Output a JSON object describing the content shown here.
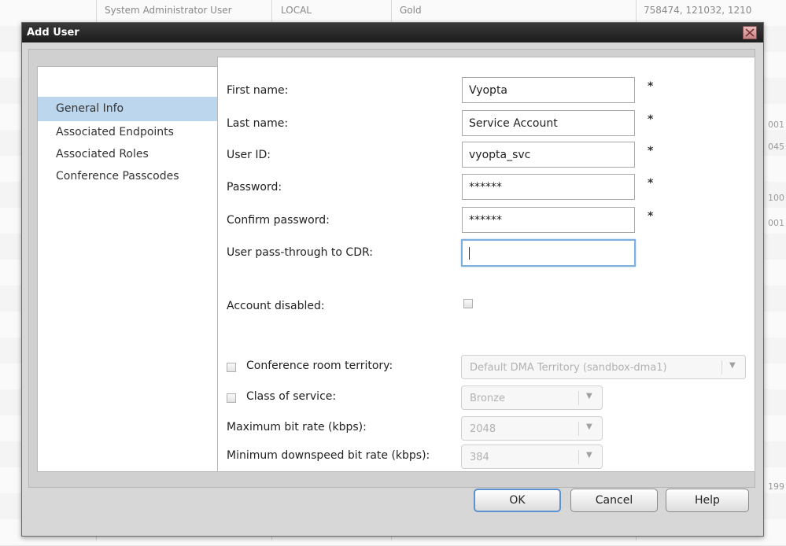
{
  "background": {
    "header_row": {
      "name": "System Administrator User",
      "type": "LOCAL",
      "class": "Gold",
      "ids": "758474, 121032, 1210"
    },
    "right_edge_fragments": [
      "001",
      "045",
      "100",
      "001",
      "199"
    ]
  },
  "dialog": {
    "title": "Add User",
    "close_icon": "close-icon",
    "nav": {
      "items": [
        {
          "label": "General Info",
          "active": true
        },
        {
          "label": "Associated Endpoints",
          "active": false
        },
        {
          "label": "Associated Roles",
          "active": false
        },
        {
          "label": "Conference Passcodes",
          "active": false
        }
      ]
    },
    "form": {
      "first_name": {
        "label": "First name:",
        "value": "Vyopta",
        "required": "*"
      },
      "last_name": {
        "label": "Last name:",
        "value": "Service Account",
        "required": "*"
      },
      "user_id": {
        "label": "User ID:",
        "value": "vyopta_svc",
        "required": "*"
      },
      "password": {
        "label": "Password:",
        "value": "******",
        "required": "*"
      },
      "confirm_password": {
        "label": "Confirm password:",
        "value": "******",
        "required": "*"
      },
      "pass_through": {
        "label": "User pass-through to CDR:",
        "value": ""
      },
      "account_disabled": {
        "label": "Account disabled:",
        "checked": false
      },
      "territory": {
        "label": "Conference room territory:",
        "value": "Default DMA Territory (sandbox-dma1)",
        "checked": false
      },
      "class_of_service": {
        "label": "Class of service:",
        "value": "Bronze",
        "checked": false
      },
      "max_bit_rate": {
        "label": "Maximum bit rate (kbps):",
        "value": "2048"
      },
      "min_downspeed": {
        "label": "Minimum downspeed bit rate (kbps):",
        "value": "384"
      }
    },
    "buttons": {
      "ok": "OK",
      "cancel": "Cancel",
      "help": "Help"
    }
  }
}
